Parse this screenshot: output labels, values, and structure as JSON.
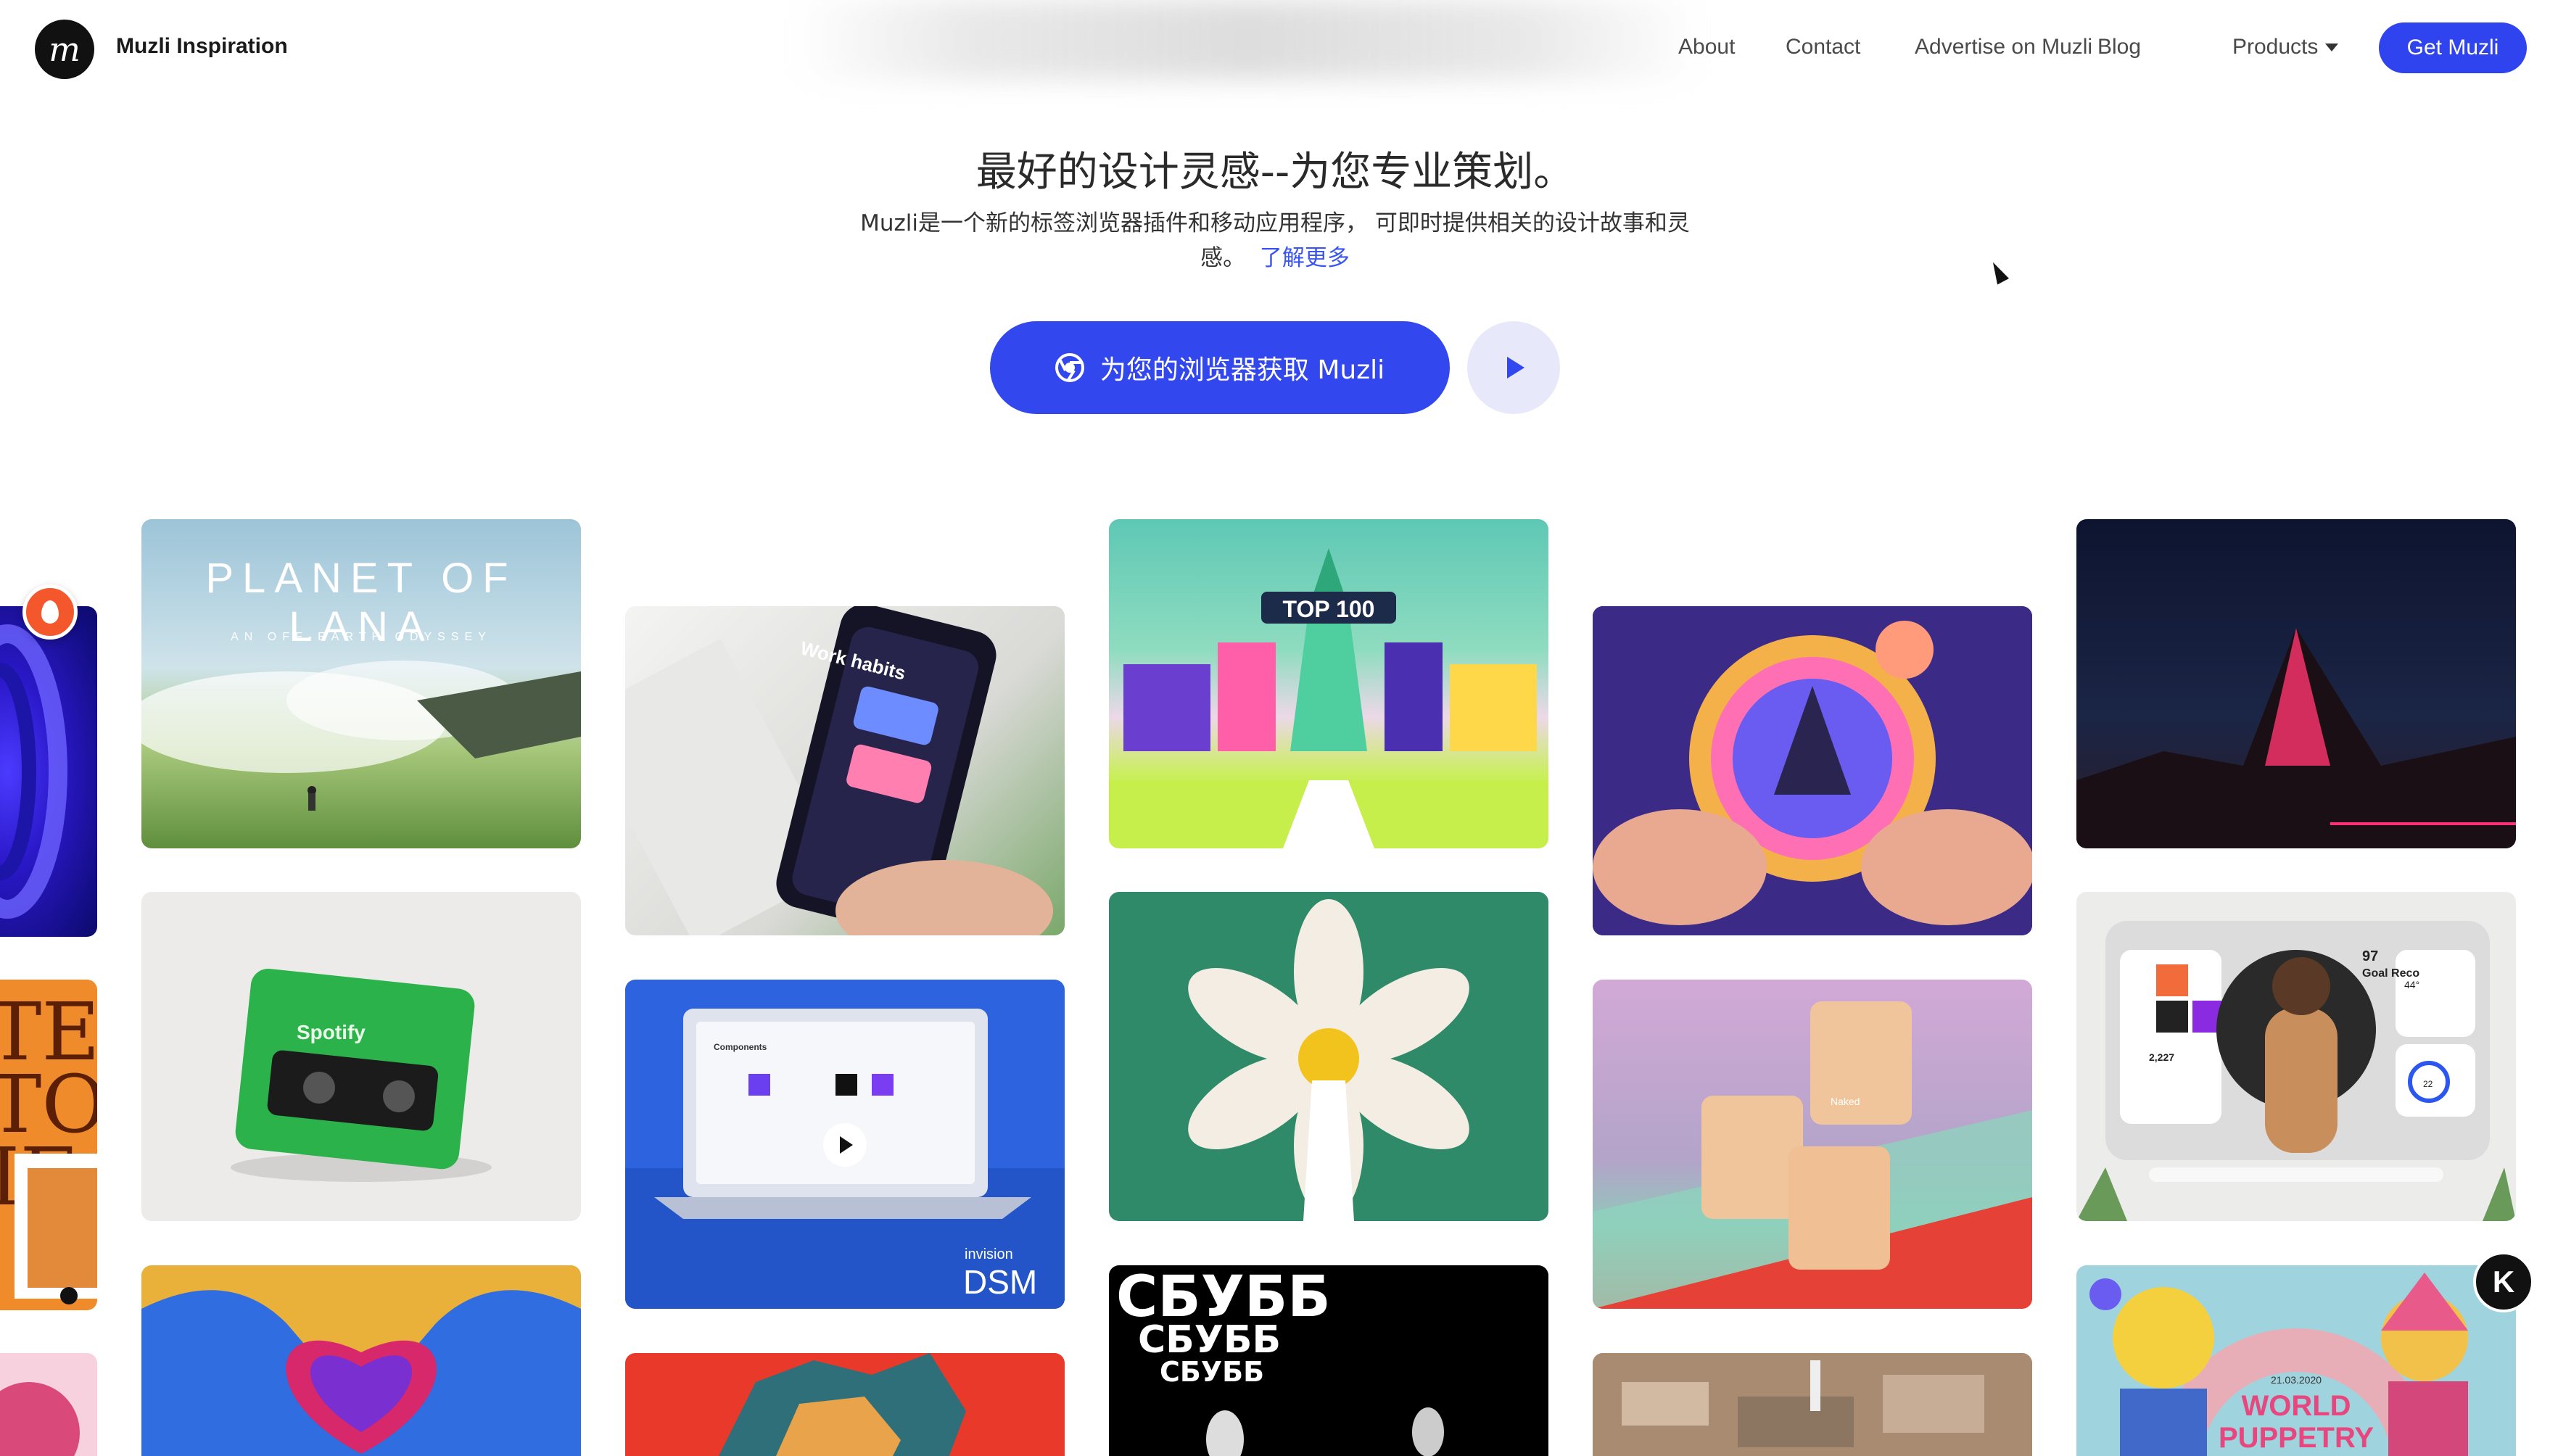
{
  "header": {
    "brand": "Muzli Inspiration",
    "logo_glyph": "m",
    "nav": {
      "about": "About",
      "contact": "Contact",
      "advertise": "Advertise on Muzli",
      "blog": "Blog",
      "products": "Products"
    },
    "cta": "Get Muzli"
  },
  "hero": {
    "title": "最好的设计灵感--为您专业策划。",
    "subtitle": "Muzli是一个新的标签浏览器插件和移动应用程序， 可即时提供相关的设计故事和灵感。",
    "learn_more": "了解更多",
    "cta": "为您的浏览器获取 Muzli"
  },
  "cards": {
    "lana_title": "PLANET OF LANA",
    "lana_sub": "AN OFF-EARTH ODYSSEY",
    "work_habits": "Work habits",
    "top100": "TOP 100",
    "spotify": "Spotify",
    "components": "Components",
    "dsm_brand": "invision",
    "dsm": "DSM",
    "nakid": "Naked",
    "goal_num": "97",
    "goal_label": "Goal Reco",
    "dash_num": "2,227",
    "dash_num2": "44°",
    "dash_num3": "22",
    "puppetry_date": "21.03.2020",
    "puppetry_line1": "WORLD",
    "puppetry_line2": "PUPPETRY",
    "typo_word": "СБУББ"
  },
  "colors": {
    "accent": "#2f44ee",
    "cta_bg": "#3347ee",
    "play_bg": "#e7e9fb",
    "fire": "#f4572b"
  },
  "icons": [
    "chrome-icon",
    "play-icon",
    "caret-down-icon",
    "fire-icon",
    "help-icon",
    "cursor-icon"
  ]
}
